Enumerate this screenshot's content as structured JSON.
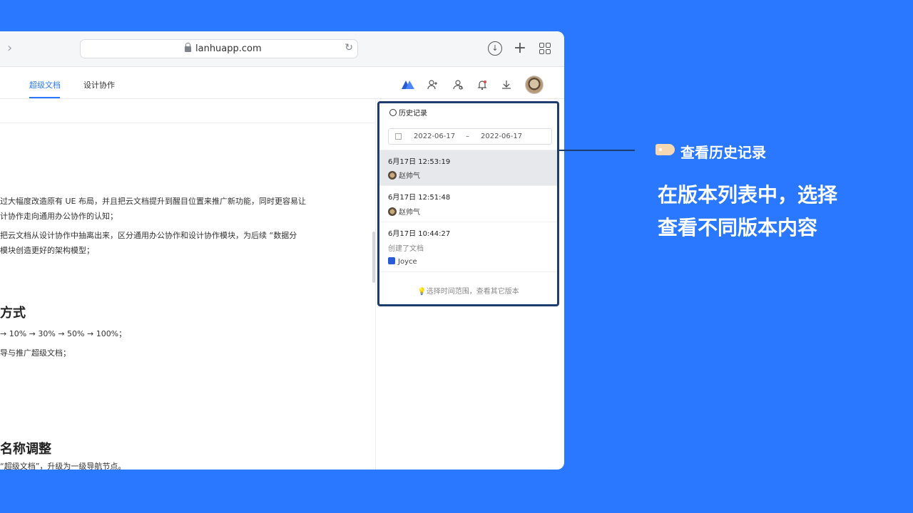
{
  "browser": {
    "url": "lanhuapp.com",
    "icons": {
      "forward": "chevron-right-icon",
      "download": "download-circle-icon",
      "new_tab": "plus-icon",
      "tabs": "grid-icon",
      "reload": "reload-icon",
      "lock": "lock-icon"
    }
  },
  "nav": {
    "tabs": [
      {
        "label": "超级文档",
        "active": true
      },
      {
        "label": "设计协作",
        "active": false
      }
    ],
    "accent_color": "#2a78ff"
  },
  "document": {
    "lines": [
      "过大幅度改造原有 UE 布局，并且把云文档提升到醒目位置来推广新功能，同时更容易让",
      "计协作走向通用办公协作的认知；",
      "把云文档从设计协作中抽离出来，区分通用办公协作和设计协作模块，为后续 “数据分",
      "模块创造更好的架构模型；"
    ],
    "heading1": "方式",
    "line5": "→ 10% → 30% → 50% → 100%；",
    "line6": "导与推广超级文档；",
    "heading2": "名称调整",
    "line7": "“超级文档”，升级为一级导航节点。"
  },
  "history": {
    "title": "历史记录",
    "date_from": "2022-06-17",
    "date_sep": "–",
    "date_to": "2022-06-17",
    "versions": [
      {
        "time": "6月17日 12:53:19",
        "user": "赵帅气"
      },
      {
        "time": "6月17日 12:51:48",
        "user": "赵帅气"
      },
      {
        "time": "6月17日 10:44:27",
        "note": "创建了文档",
        "user": "Joyce"
      }
    ],
    "tip": "选择时间范围，查看其它版本"
  },
  "callout": {
    "title": "查看历史记录",
    "line1": "在版本列表中，选择",
    "line2": "查看不同版本内容"
  }
}
